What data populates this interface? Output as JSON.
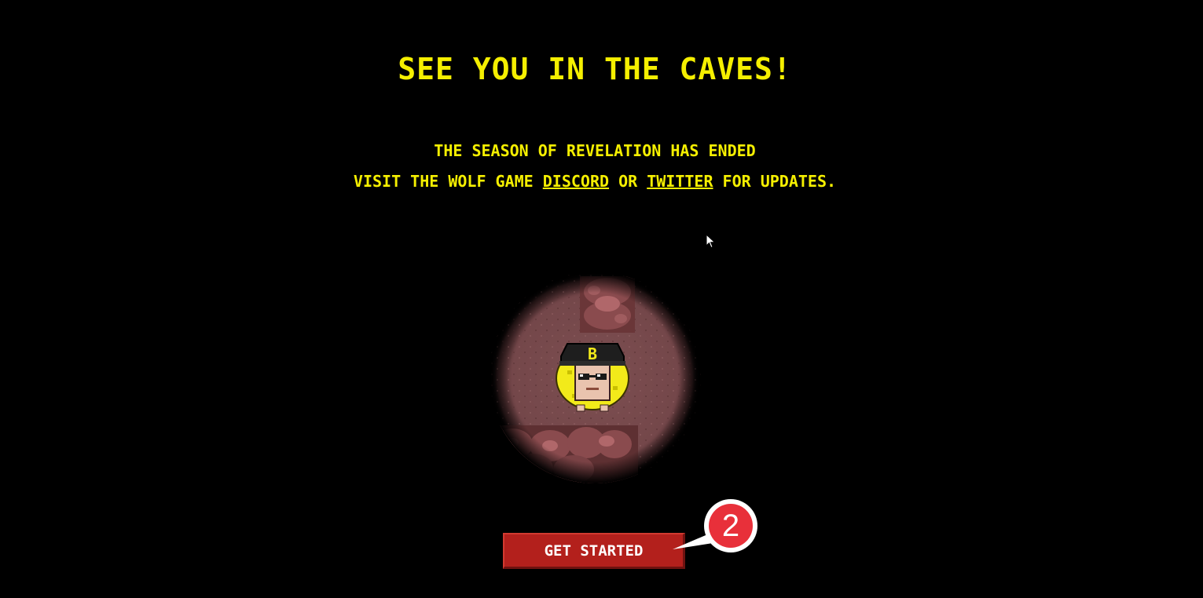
{
  "header": {
    "title": "SEE YOU IN THE CAVES!"
  },
  "message": {
    "line1": "THE SEASON OF REVELATION HAS ENDED",
    "line2_prefix": "VISIT THE WOLF GAME ",
    "discord_link": "DISCORD",
    "line2_middle": " OR ",
    "twitter_link": "TWITTER",
    "line2_suffix": " FOR UPDATES."
  },
  "character": {
    "hat_letter": "B"
  },
  "cta": {
    "label": "GET STARTED"
  },
  "annotation": {
    "step_number": "2"
  },
  "colors": {
    "background": "#000000",
    "title_yellow": "#f5ef00",
    "button_red": "#b3201c",
    "cave_floor": "#7a4a4c",
    "callout_red": "#e8303a"
  }
}
